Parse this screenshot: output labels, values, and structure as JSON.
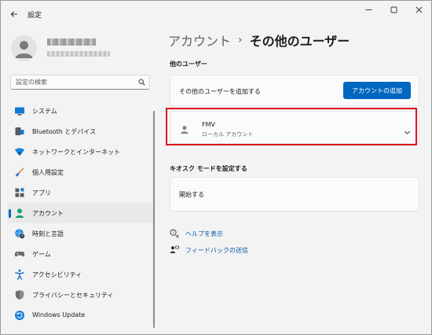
{
  "window": {
    "title": "設定",
    "controls": [
      "minimize-icon",
      "maximize-icon",
      "close-icon"
    ]
  },
  "search": {
    "placeholder": "設定の検索"
  },
  "sidebar": {
    "items": [
      {
        "label": "システム",
        "icon": "monitor-icon"
      },
      {
        "label": "Bluetooth とデバイス",
        "icon": "bluetooth-icon"
      },
      {
        "label": "ネットワークとインターネット",
        "icon": "wifi-icon"
      },
      {
        "label": "個人用設定",
        "icon": "brush-icon"
      },
      {
        "label": "アプリ",
        "icon": "apps-icon"
      },
      {
        "label": "アカウント",
        "icon": "account-icon",
        "selected": true
      },
      {
        "label": "時刻と言語",
        "icon": "globe-clock-icon"
      },
      {
        "label": "ゲーム",
        "icon": "gamepad-icon"
      },
      {
        "label": "アクセシビリティ",
        "icon": "accessibility-icon"
      },
      {
        "label": "プライバシーとセキュリティ",
        "icon": "shield-icon"
      },
      {
        "label": "Windows Update",
        "icon": "update-icon"
      }
    ]
  },
  "breadcrumb": {
    "parent": "アカウント",
    "separator": "›",
    "current": "その他のユーザー"
  },
  "other_users": {
    "heading": "他のユーザー",
    "add_row_label": "その他のユーザーを追加する",
    "add_button": "アカウントの追加",
    "user": {
      "name": "FMV",
      "type": "ローカル アカウント"
    }
  },
  "kiosk": {
    "heading": "キオスク モードを設定する",
    "start_label": "開始する"
  },
  "links": {
    "help": "ヘルプを表示",
    "feedback": "フィードバックの送信"
  },
  "colors": {
    "accent": "#0067c0",
    "highlight_border": "#d9141d"
  }
}
